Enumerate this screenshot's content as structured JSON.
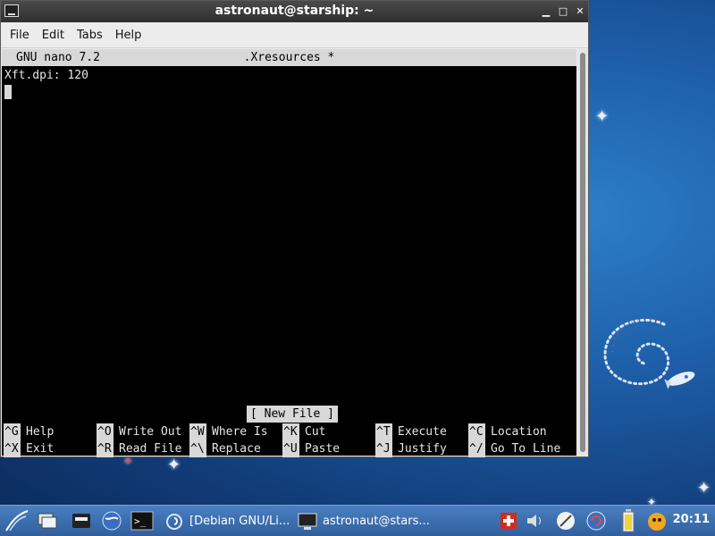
{
  "window": {
    "title": "astronaut@starship: ~",
    "menu": [
      "File",
      "Edit",
      "Tabs",
      "Help"
    ],
    "minimize_glyph": "▁",
    "maximize_glyph": "□",
    "close_glyph": "✕"
  },
  "nano": {
    "version": "GNU nano 7.2",
    "filename": ".Xresources *",
    "lines": [
      "Xft.dpi: 120"
    ],
    "status": "[ New File ]",
    "shortcuts_row1": [
      {
        "key": "^G",
        "label": "Help"
      },
      {
        "key": "^O",
        "label": "Write Out"
      },
      {
        "key": "^W",
        "label": "Where Is"
      },
      {
        "key": "^K",
        "label": "Cut"
      },
      {
        "key": "^T",
        "label": "Execute"
      },
      {
        "key": "^C",
        "label": "Location"
      }
    ],
    "shortcuts_row2": [
      {
        "key": "^X",
        "label": "Exit"
      },
      {
        "key": "^R",
        "label": "Read File"
      },
      {
        "key": "^\\",
        "label": "Replace"
      },
      {
        "key": "^U",
        "label": "Paste"
      },
      {
        "key": "^J",
        "label": "Justify"
      },
      {
        "key": "^/",
        "label": "Go To Line"
      }
    ]
  },
  "taskbar": {
    "tasks": [
      {
        "label": "[Debian GNU/Li..."
      },
      {
        "label": "astronaut@stars..."
      }
    ],
    "clock": "20:11",
    "icons": [
      "app-menu-icon",
      "show-desktop-icon",
      "file-manager-icon",
      "web-browser-icon",
      "terminal-icon",
      "swiss-flag-icon",
      "volume-icon",
      "network-icon",
      "update-icon",
      "battery-icon",
      "notification-icon"
    ]
  }
}
